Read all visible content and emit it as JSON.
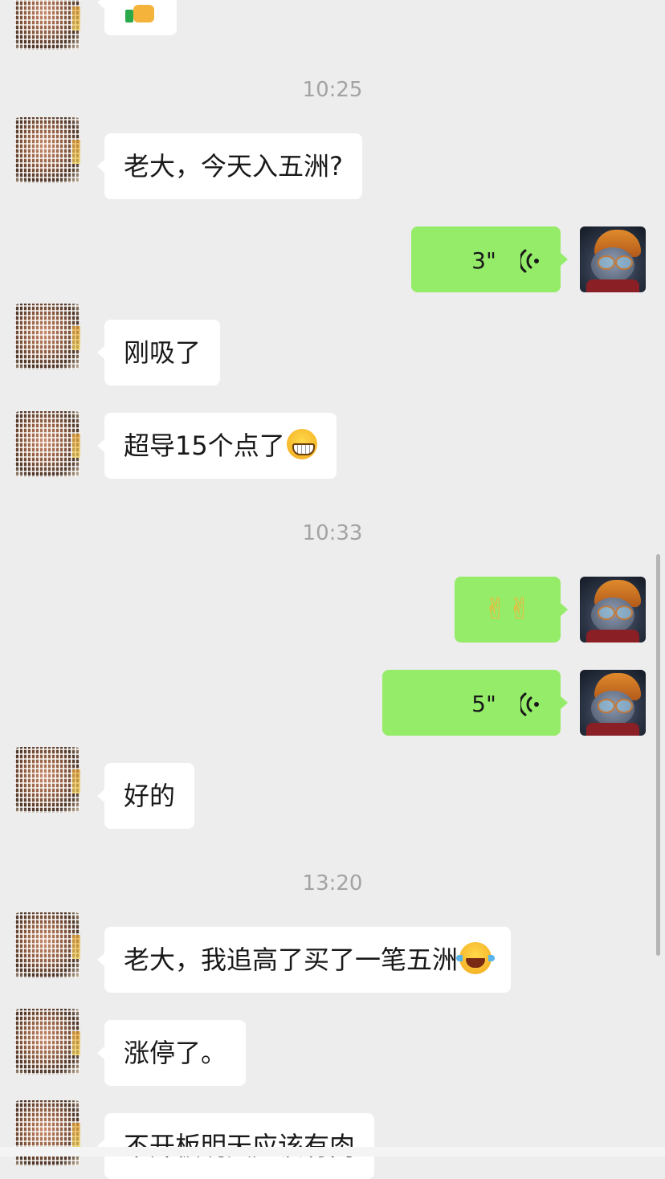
{
  "timestamps": [
    "10:25",
    "10:33",
    "13:20"
  ],
  "messages": {
    "m1": "老大，今天入五洲?",
    "m2_voice": "3\"",
    "m3": "刚吸了",
    "m4": "超导15个点了",
    "m5_emoji": "✌✌",
    "m6_voice": "5\"",
    "m7": "好的",
    "m8": "老大，我追高了买了一笔五洲",
    "m9": "涨停了。",
    "m10": "不开板明天应该有肉"
  },
  "icons": {
    "top": "thumbs-up-emoji",
    "grin": "grinning-emoji",
    "laugh": "tears-of-joy-emoji",
    "voice": "voice-wave-icon"
  },
  "colors": {
    "background": "#ededed",
    "sent_bubble": "#95ec69",
    "received_bubble": "#ffffff",
    "timestamp": "#a3a3a3"
  }
}
